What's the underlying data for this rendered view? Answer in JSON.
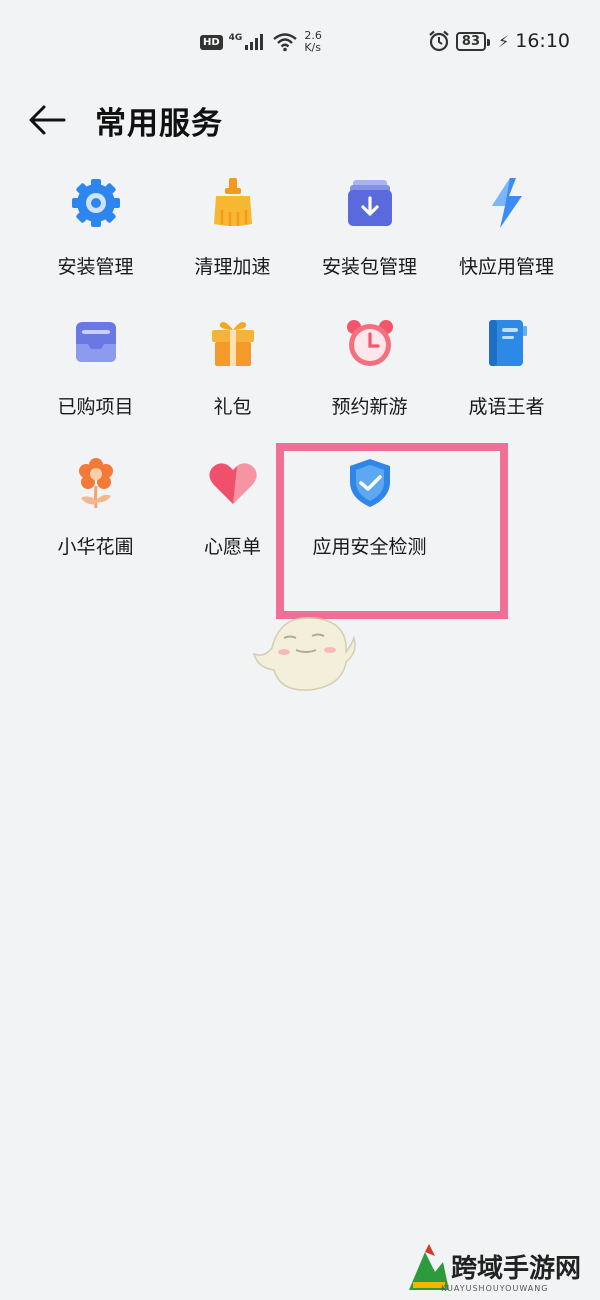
{
  "status_bar": {
    "hd": "HD",
    "network": "4G",
    "speed_value": "2.6",
    "speed_unit": "K/s",
    "battery": "83",
    "time": "16:10"
  },
  "header": {
    "title": "常用服务"
  },
  "services": [
    {
      "label": "安装管理",
      "icon": "gear-icon"
    },
    {
      "label": "清理加速",
      "icon": "broom-icon"
    },
    {
      "label": "安装包管理",
      "icon": "package-download-icon"
    },
    {
      "label": "快应用管理",
      "icon": "lightning-icon"
    },
    {
      "label": "已购项目",
      "icon": "purchased-tray-icon"
    },
    {
      "label": "礼包",
      "icon": "gift-icon"
    },
    {
      "label": "预约新游",
      "icon": "alarm-clock-icon"
    },
    {
      "label": "成语王者",
      "icon": "book-icon"
    },
    {
      "label": "小华花圃",
      "icon": "flower-icon"
    },
    {
      "label": "心愿单",
      "icon": "heart-icon"
    },
    {
      "label": "应用安全检测",
      "icon": "shield-check-icon"
    }
  ],
  "highlight_color": "#ef6f96",
  "watermark": {
    "title": "跨域手游网",
    "subtitle": "KUAYUSHOUYOUWANG"
  }
}
